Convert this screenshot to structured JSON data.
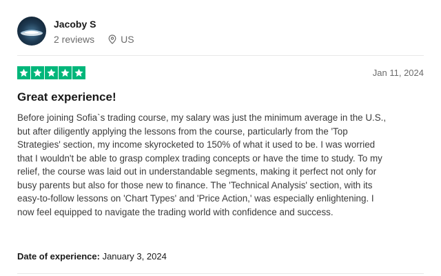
{
  "reviewer": {
    "name": "Jacoby S",
    "reviews": "2 reviews",
    "country": "US",
    "avatar_icon": "avatar-photo"
  },
  "rating": {
    "stars": 5,
    "max": 5,
    "color": "#00b67a"
  },
  "review": {
    "date": "Jan 11, 2024",
    "title": "Great experience!",
    "body": "Before joining Sofia`s trading course, my salary was just the minimum average in the U.S., but after diligently applying the lessons from the course, particularly from the 'Top Strategies' section, my income skyrocketed to 150% of what it used to be. I was worried that I wouldn't be able to grasp complex trading concepts or have the time to study. To my relief, the course was laid out in understandable segments, making it perfect not only for busy parents but also for those new to finance. The 'Technical Analysis' section, with its easy-to-follow lessons on 'Chart Types' and 'Price Action,' was especially enlightening. I now feel equipped to navigate the trading world with confidence and success."
  },
  "experience": {
    "label": "Date of experience:",
    "value": "January 3, 2024"
  }
}
